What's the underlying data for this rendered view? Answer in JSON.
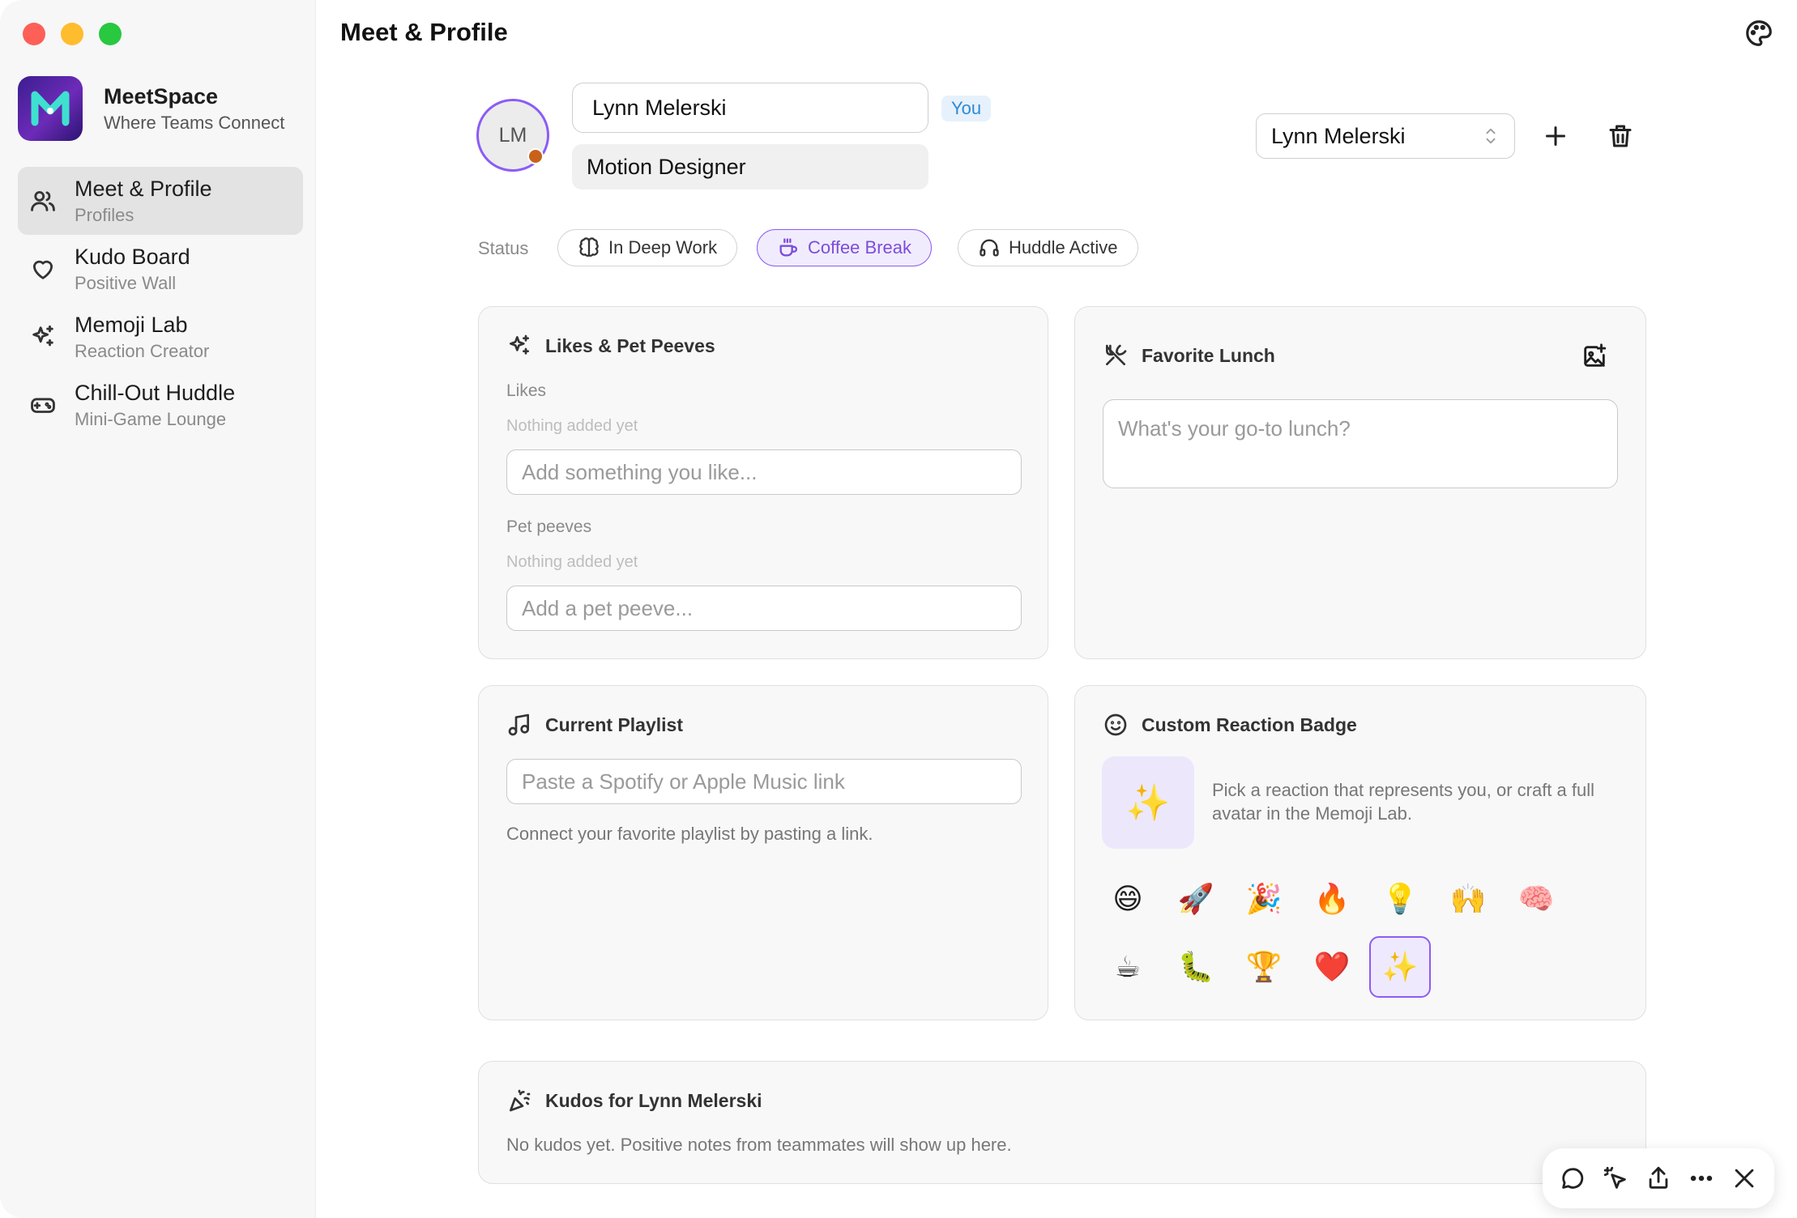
{
  "sidebar": {
    "brand_name": "MeetSpace",
    "brand_tagline": "Where Teams Connect",
    "items": [
      {
        "title": "Meet & Profile",
        "subtitle": "Profiles",
        "icon": "users-icon"
      },
      {
        "title": "Kudo Board",
        "subtitle": "Positive Wall",
        "icon": "heart-icon"
      },
      {
        "title": "Memoji Lab",
        "subtitle": "Reaction Creator",
        "icon": "sparkles-icon"
      },
      {
        "title": "Chill-Out Huddle",
        "subtitle": "Mini-Game Lounge",
        "icon": "gamepad-icon"
      }
    ]
  },
  "header": {
    "title": "Meet & Profile"
  },
  "profile": {
    "initials": "LM",
    "name": "Lynn Melerski",
    "you_label": "You",
    "role": "Motion Designer",
    "selected_profile": "Lynn Melerski"
  },
  "status": {
    "label": "Status",
    "options": [
      "In Deep Work",
      "Coffee Break",
      "Huddle Active"
    ],
    "active": "Coffee Break"
  },
  "likes_card": {
    "title": "Likes & Pet Peeves",
    "likes_label": "Likes",
    "likes_empty": "Nothing added yet",
    "likes_placeholder": "Add something you like...",
    "peeves_label": "Pet peeves",
    "peeves_empty": "Nothing added yet",
    "peeves_placeholder": "Add a pet peeve..."
  },
  "lunch_card": {
    "title": "Favorite Lunch",
    "placeholder": "What's your go-to lunch?"
  },
  "playlist_card": {
    "title": "Current Playlist",
    "placeholder": "Paste a Spotify or Apple Music link",
    "help": "Connect your favorite playlist by pasting a link."
  },
  "badge_card": {
    "title": "Custom Reaction Badge",
    "preview": "✨",
    "description": "Pick a reaction that represents you, or craft a full avatar in the Memoji Lab.",
    "emojis": [
      "😄",
      "🚀",
      "🎉",
      "🔥",
      "💡",
      "🙌",
      "🧠",
      "☕",
      "🐛",
      "🏆",
      "❤️",
      "✨"
    ],
    "selected_emoji": "✨"
  },
  "kudos_card": {
    "title": "Kudos for Lynn Melerski",
    "empty": "No kudos yet. Positive notes from teammates will show up here."
  },
  "colors": {
    "accent": "#8b5cf6",
    "you_badge": "#2d8ad6",
    "avatar_dot": "#c8621a"
  }
}
